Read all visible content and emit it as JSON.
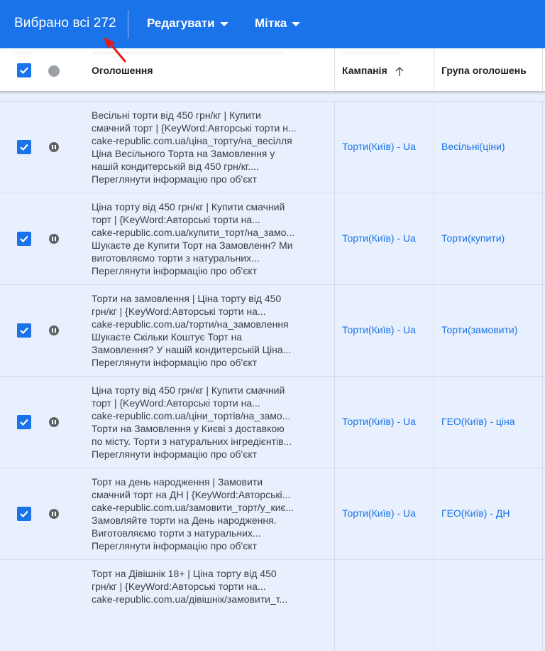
{
  "topbar": {
    "selected_text": "Вибрано всі 272",
    "edit_label": "Редагувати",
    "label_label": "Мітка",
    "bg_color": "#1a73e8"
  },
  "table": {
    "headers": {
      "ad": "Оголошення",
      "campaign": "Кампанія",
      "ad_group": "Група оголошень"
    },
    "rows": [
      {
        "lines": [
          "Весільні торти від 450 грн/кг | Купити",
          "смачний торт | {KeyWord:Авторські торти н...",
          "cake-republic.com.ua/ціна_торту/на_весілля",
          "Ціна Весільного Торта на Замовлення у",
          "нашій кондитерській від 450 грн/кг....",
          "Переглянути інформацію про об'єкт"
        ],
        "campaign": "Торти(Київ) - Ua",
        "group": "Весільні(ціни)"
      },
      {
        "lines": [
          "Ціна торту від 450 грн/кг | Купити смачний",
          "торт | {KeyWord:Авторські торти на...",
          "cake-republic.com.ua/купити_торт/на_замо...",
          "Шукаєте де Купити Торт на Замовленн? Ми",
          "виготовляємо торти з натуральних...",
          "Переглянути інформацію про об'єкт"
        ],
        "campaign": "Торти(Київ) - Ua",
        "group": "Торти(купити)"
      },
      {
        "lines": [
          "Торти на замовлення | Ціна торту від 450",
          "грн/кг | {KeyWord:Авторські торти на...",
          "cake-republic.com.ua/торти/на_замовлення",
          "Шукаєте Скільки Коштує Торт на",
          "Замовлення? У нашій кондитерській Ціна...",
          "Переглянути інформацію про об'єкт"
        ],
        "campaign": "Торти(Київ) - Ua",
        "group": "Торти(замовити)"
      },
      {
        "lines": [
          "Ціна торту від 450 грн/кг | Купити смачний",
          "торт | {KeyWord:Авторські торти на...",
          "cake-republic.com.ua/ціни_тортів/на_замо...",
          "Торти на Замовлення у Києві з доставкою",
          "по місту. Торти з натуральних інгредієнтів...",
          "Переглянути інформацію про об'єкт"
        ],
        "campaign": "Торти(Київ) - Ua",
        "group": "ГЕО(Київ) - ціна"
      },
      {
        "lines": [
          "Торт на день народження | Замовити",
          "смачний торт на ДН | {KeyWord:Авторські...",
          "cake-republic.com.ua/замовити_торт/у_киє...",
          "Замовляйте торти на День народження.",
          "Виготовляємо торти з натуральних...",
          "Переглянути інформацію про об'єкт"
        ],
        "campaign": "Торти(Київ) - Ua",
        "group": "ГЕО(Київ) - ДН"
      },
      {
        "lines": [
          "Торт на Дівішнік 18+ | Ціна торту від 450",
          "грн/кг | {KeyWord:Авторські торти на...",
          "cake-republic.com.ua/дівішнік/замовити_т...",
          "",
          "",
          ""
        ],
        "campaign": "",
        "group": ""
      }
    ]
  }
}
